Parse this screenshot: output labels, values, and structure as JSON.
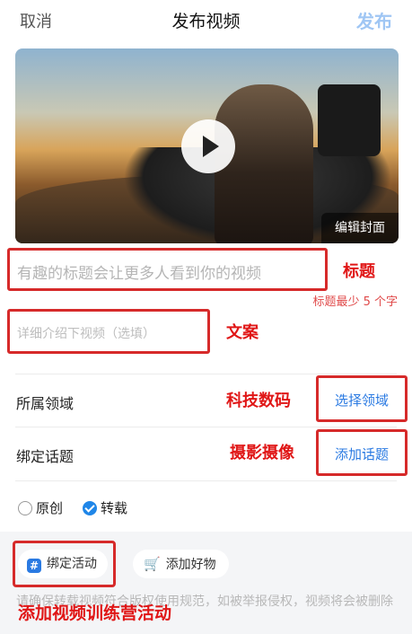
{
  "header": {
    "cancel": "取消",
    "title": "发布视频",
    "publish": "发布"
  },
  "video": {
    "edit_cover": "编辑封面"
  },
  "title_field": {
    "placeholder": "有趣的标题会让更多人看到你的视频",
    "hint": "标题最少 5 个字"
  },
  "desc_field": {
    "placeholder": "详细介绍下视频（选填）"
  },
  "rows": [
    {
      "label": "所属领域",
      "action": "选择领域"
    },
    {
      "label": "绑定话题",
      "action": "添加话题"
    }
  ],
  "source": {
    "original": "原创",
    "repost": "转载",
    "selected": "转载"
  },
  "chips": {
    "bind_activity": "绑定活动",
    "add_goods": "添加好物"
  },
  "notice": "请确保转载视频符合版权使用规范，如被举报侵权，视频将会被删除",
  "annotations": {
    "title": "标题",
    "copy": "文案",
    "domain": "科技数码",
    "topic": "摄影摄像",
    "activity": "添加视频训练营活动"
  },
  "colors": {
    "accent": "#2a7ae2",
    "annotation": "#e01616",
    "publish_disabled": "#9fc6f4"
  }
}
